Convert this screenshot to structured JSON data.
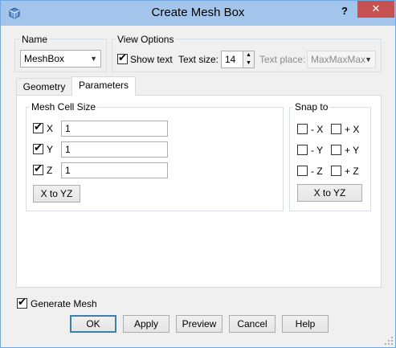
{
  "window": {
    "title": "Create Mesh Box",
    "help": "?",
    "close": "✕"
  },
  "name_group": {
    "label": "Name",
    "value": "MeshBox"
  },
  "view_options": {
    "label": "View Options",
    "show_text_label": "Show text",
    "show_text_checked": true,
    "text_size_label": "Text size:",
    "text_size_value": "14",
    "text_place_label": "Text place:",
    "text_place_value": "MaxMaxMax"
  },
  "tabs": [
    {
      "label": "Geometry",
      "active": false
    },
    {
      "label": "Parameters",
      "active": true
    }
  ],
  "mesh_cell_size": {
    "label": "Mesh Cell Size",
    "rows": [
      {
        "axis": "X",
        "checked": true,
        "value": "1"
      },
      {
        "axis": "Y",
        "checked": true,
        "value": "1"
      },
      {
        "axis": "Z",
        "checked": true,
        "value": "1"
      }
    ],
    "button": "X to YZ"
  },
  "snap_to": {
    "label": "Snap to",
    "options": [
      {
        "label": "- X",
        "checked": false
      },
      {
        "label": "+ X",
        "checked": false
      },
      {
        "label": "- Y",
        "checked": false
      },
      {
        "label": "+ Y",
        "checked": false
      },
      {
        "label": "- Z",
        "checked": false
      },
      {
        "label": "+ Z",
        "checked": false
      }
    ],
    "button": "X to YZ"
  },
  "generate_mesh": {
    "label": "Generate Mesh",
    "checked": true
  },
  "buttons": {
    "ok": "OK",
    "apply": "Apply",
    "preview": "Preview",
    "cancel": "Cancel",
    "help": "Help"
  },
  "colors": {
    "titlebar": "#a3c5ec",
    "close": "#c75050",
    "window_bg": "#f0f0f0"
  },
  "icons": {
    "app": "mesh-box-app-icon",
    "dropdown": "chevron-down-icon",
    "check": "checkmark-icon"
  }
}
